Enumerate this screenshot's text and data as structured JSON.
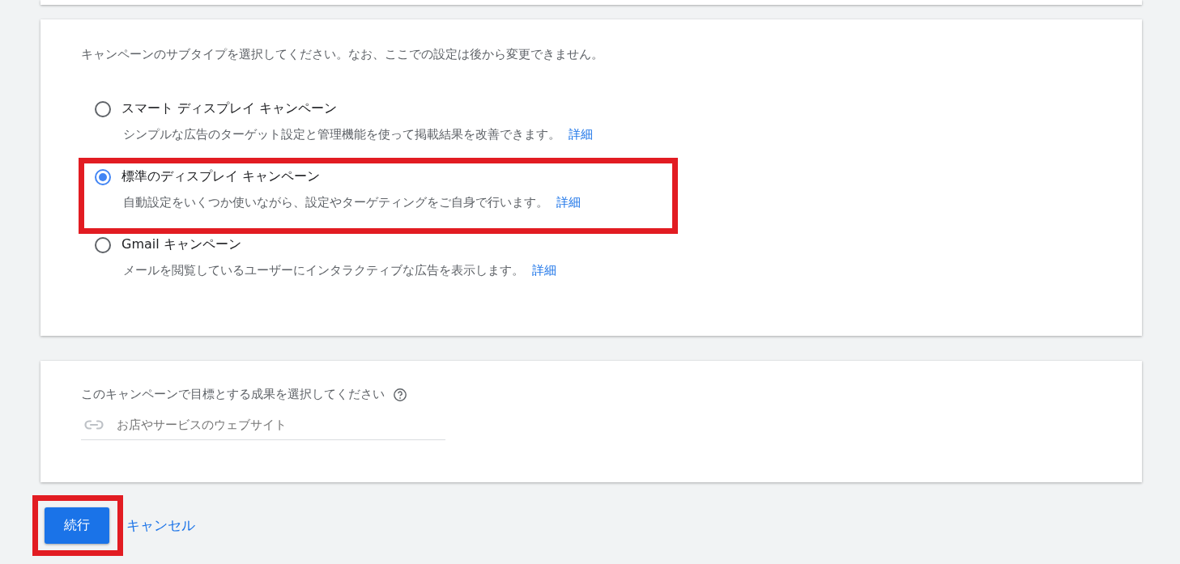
{
  "subtype_card": {
    "prompt": "キャンペーンのサブタイプを選択してください。なお、ここでの設定は後から変更できません。",
    "options": [
      {
        "label": "スマート ディスプレイ キャンペーン",
        "description": "シンプルな広告のターゲット設定と管理機能を使って掲載結果を改善できます。",
        "link": "詳細",
        "selected": false,
        "highlighted": false
      },
      {
        "label": "標準のディスプレイ キャンペーン",
        "description": "自動設定をいくつか使いながら、設定やターゲティングをご自身で行います。",
        "link": "詳細",
        "selected": true,
        "highlighted": true
      },
      {
        "label": "Gmail キャンペーン",
        "description": "メールを閲覧しているユーザーにインタラクティブな広告を表示します。",
        "link": "詳細",
        "selected": false,
        "highlighted": false
      }
    ]
  },
  "goal_card": {
    "prompt": "このキャンペーンで目標とする成果を選択してください",
    "goal_field": {
      "placeholder": "お店やサービスのウェブサイト"
    }
  },
  "actions": {
    "continue": {
      "label": "続行",
      "highlighted": true
    },
    "cancel": {
      "label": "キャンセル"
    }
  }
}
